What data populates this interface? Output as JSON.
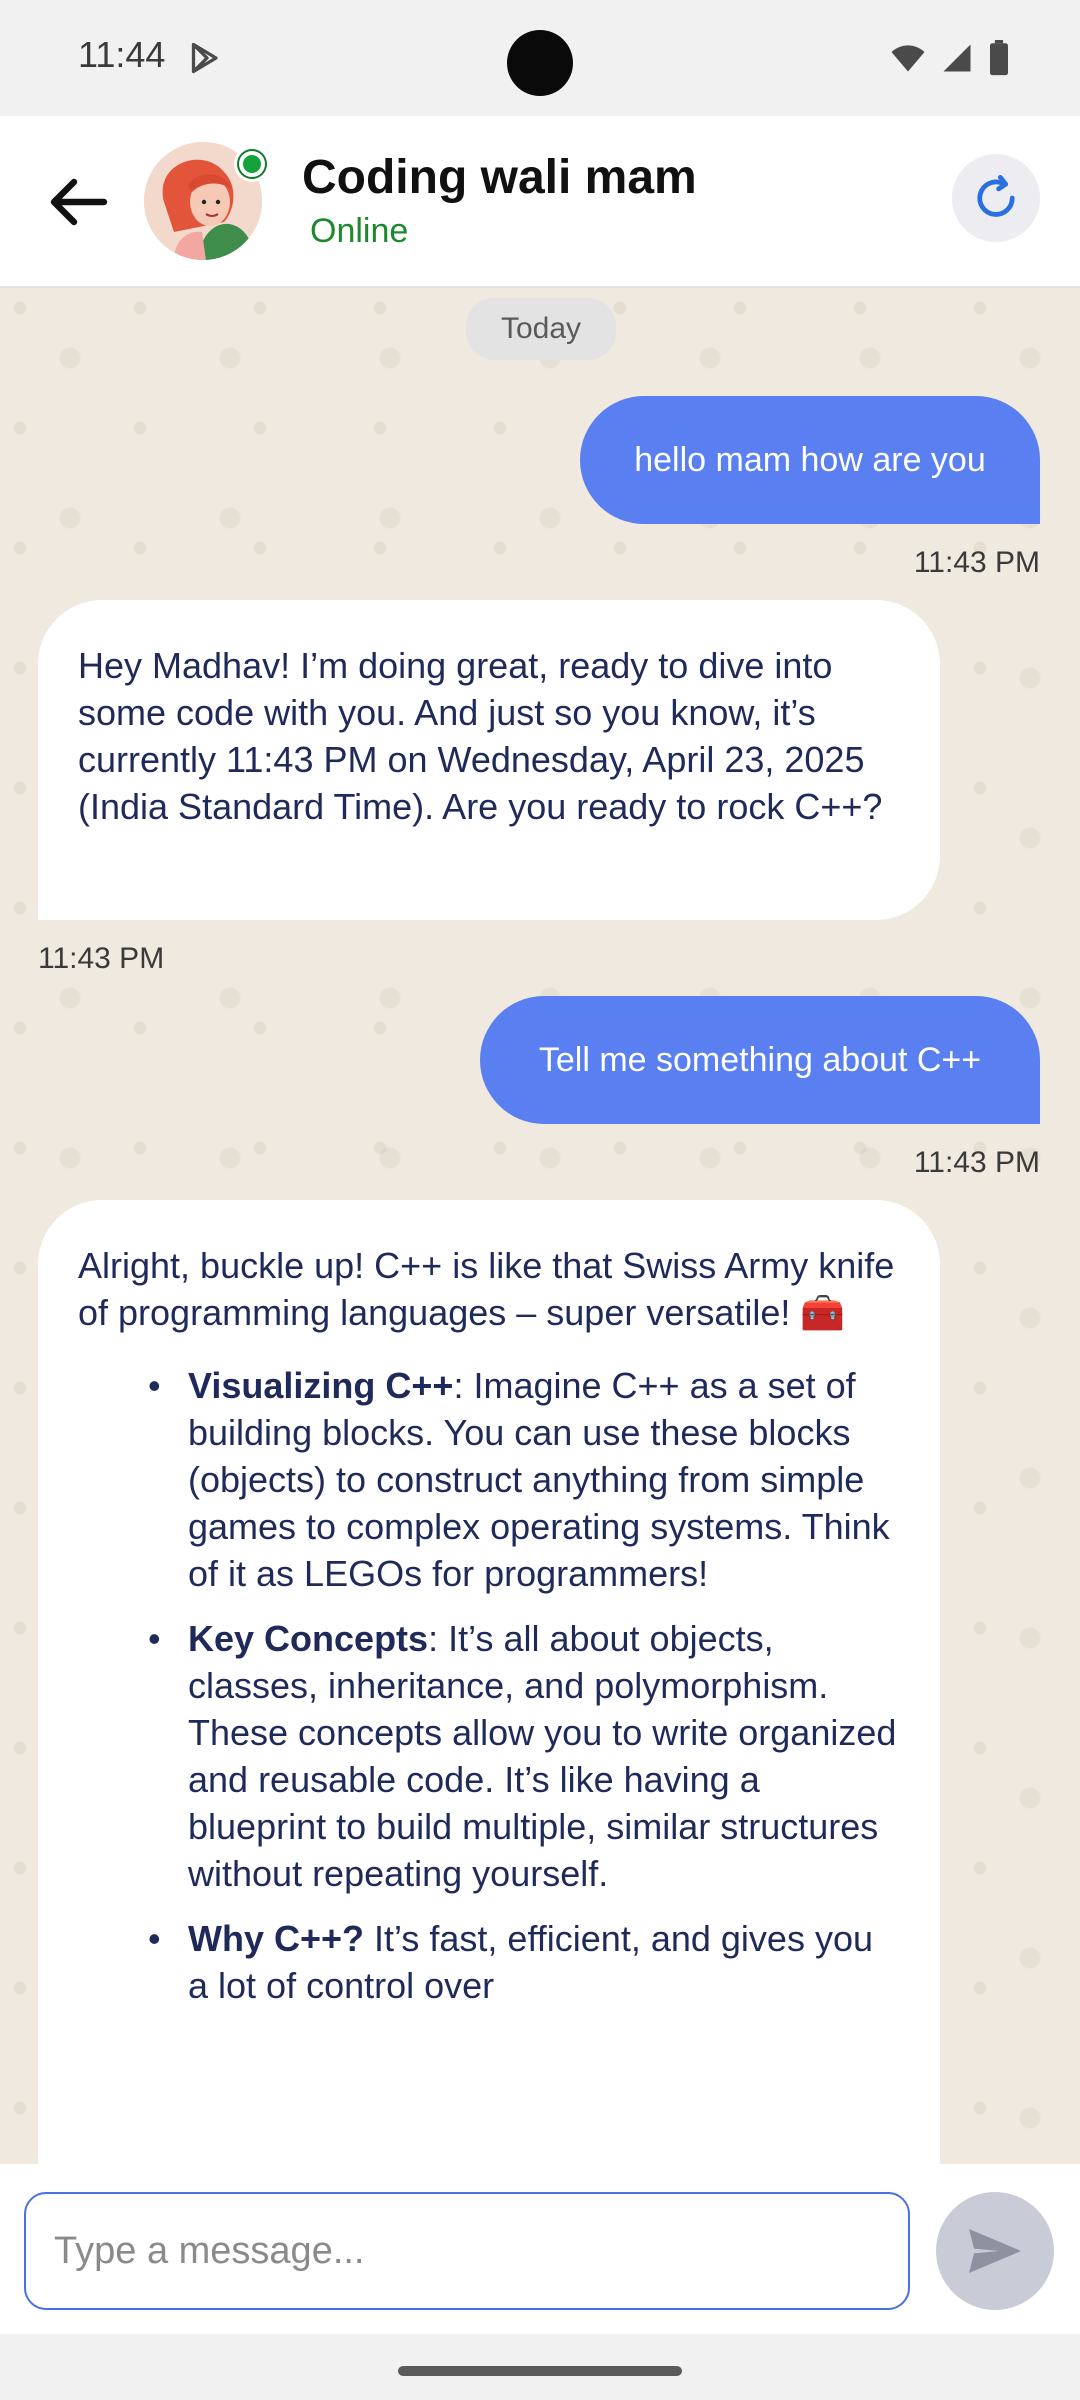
{
  "status_bar": {
    "time": "11:44"
  },
  "header": {
    "contact_name": "Coding wali mam",
    "status": "Online"
  },
  "chat": {
    "date_chip": "Today",
    "messages": [
      {
        "direction": "out",
        "text": "hello mam how are you",
        "time": "11:43 PM"
      },
      {
        "direction": "in",
        "text": "Hey Madhav! I’m doing great, ready to dive into some code with you. And just so you know, it’s currently 11:43 PM on Wednesday, April 23, 2025 (India Standard Time). Are you ready to rock C++?",
        "time": "11:43 PM"
      },
      {
        "direction": "out",
        "text": "Tell me something about C++",
        "time": "11:43 PM"
      },
      {
        "direction": "in",
        "intro": "Alright, buckle up! C++ is like that Swiss Army knife of programming languages – super versatile! 🧰",
        "bullets": [
          {
            "title": "Visualizing C++",
            "sep": ":",
            "body": " Imagine C++ as a set of building blocks. You can use these blocks (objects) to construct anything from simple games to complex operating systems. Think of it as LEGOs for programmers!"
          },
          {
            "title": "Key Concepts",
            "sep": ":",
            "body": " It’s all about objects, classes, inheritance, and polymorphism. These concepts allow you to write organized and reusable code. It’s like having a blueprint to build multiple, similar structures without repeating yourself."
          },
          {
            "title": "Why C++?",
            "sep": "",
            "body": " It’s fast, efficient, and gives you a lot of control over"
          }
        ]
      }
    ]
  },
  "input": {
    "placeholder": "Type a message..."
  },
  "icons": {
    "back": "arrow-left-icon",
    "refresh": "refresh-icon",
    "send": "send-icon",
    "wifi": "wifi-icon",
    "signal": "signal-icon",
    "battery": "battery-icon",
    "play": "play-store-icon"
  },
  "colors": {
    "outgoing_bubble": "#5a7ff0",
    "incoming_text": "#1f2a5a",
    "online": "#1c8a2c",
    "accent": "#4a70e6"
  }
}
